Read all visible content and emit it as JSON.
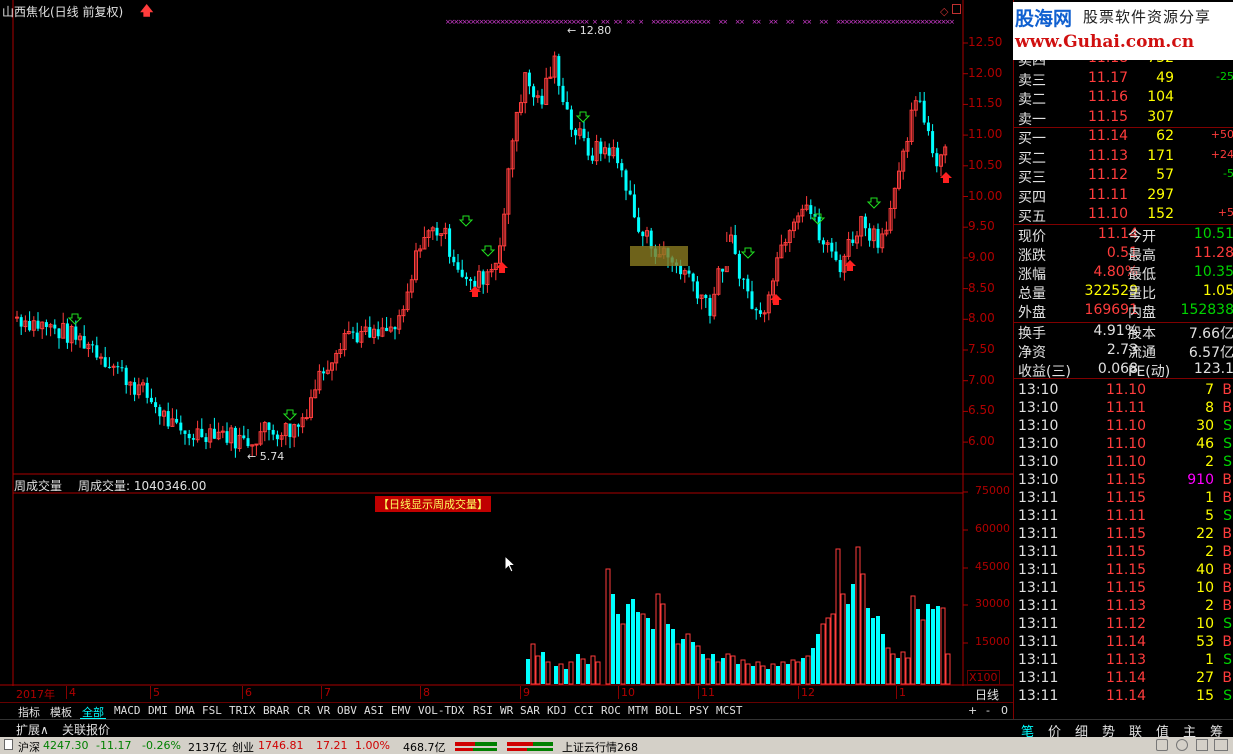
{
  "header": {
    "stock_title": "山西焦化(日线 前复权)",
    "high_mark": "12.80",
    "low_mark": "5.74"
  },
  "price_axis": [
    "12.50",
    "12.00",
    "11.50",
    "11.00",
    "10.50",
    "10.00",
    "9.50",
    "9.00",
    "8.50",
    "8.00",
    "7.50",
    "7.00",
    "6.50",
    "6.00"
  ],
  "volume_panel": {
    "label1": "周成交量",
    "label2": "周成交量: 1040346.00",
    "notice": "【日线显示周成交量】",
    "axis": [
      "75000",
      "60000",
      "45000",
      "30000",
      "15000"
    ],
    "unit": "X100"
  },
  "months": {
    "year": "2017年",
    "labels": [
      "4",
      "5",
      "6",
      "7",
      "8",
      "9",
      "10",
      "11",
      "12",
      "1"
    ],
    "period": "日线"
  },
  "indicator_tabs": [
    "指标",
    "模板",
    "全部",
    "MACD",
    "DMI",
    "DMA",
    "FSL",
    "TRIX",
    "BRAR",
    "CR",
    "VR",
    "OBV",
    "ASI",
    "EMV",
    "VOL-TDX",
    "RSI",
    "WR",
    "SAR",
    "KDJ",
    "CCI",
    "ROC",
    "MTM",
    "BOLL",
    "PSY",
    "MCST"
  ],
  "zoom_controls": [
    "+",
    "-",
    "0"
  ],
  "expand_bar": {
    "expand": "扩展∧",
    "related": "关联报价"
  },
  "watermark": {
    "brand": "股海网",
    "slogan": "股票软件资源分享",
    "url": "www.Guhai.com.cn"
  },
  "order_book": [
    {
      "label": "卖四",
      "price": "11.18",
      "vol": "732",
      "chg": ""
    },
    {
      "label": "卖三",
      "price": "11.17",
      "vol": "49",
      "chg": "-25"
    },
    {
      "label": "卖二",
      "price": "11.16",
      "vol": "104",
      "chg": ""
    },
    {
      "label": "卖一",
      "price": "11.15",
      "vol": "307",
      "chg": ""
    },
    {
      "label": "买一",
      "price": "11.14",
      "vol": "62",
      "chg": "+50"
    },
    {
      "label": "买二",
      "price": "11.13",
      "vol": "171",
      "chg": "+24"
    },
    {
      "label": "买三",
      "price": "11.12",
      "vol": "57",
      "chg": "-5"
    },
    {
      "label": "买四",
      "price": "11.11",
      "vol": "297",
      "chg": ""
    },
    {
      "label": "买五",
      "price": "11.10",
      "vol": "152",
      "chg": "+5"
    }
  ],
  "stats": [
    {
      "l1": "现价",
      "v1": "11.14",
      "l2": "今开",
      "v2": "10.51"
    },
    {
      "l1": "涨跌",
      "v1": "0.51",
      "l2": "最高",
      "v2": "11.28"
    },
    {
      "l1": "涨幅",
      "v1": "4.80%",
      "l2": "最低",
      "v2": "10.35"
    },
    {
      "l1": "总量",
      "v1": "322529",
      "l2": "量比",
      "v2": "1.05"
    },
    {
      "l1": "外盘",
      "v1": "169691",
      "l2": "内盘",
      "v2": "152838"
    }
  ],
  "stats2": [
    {
      "l1": "换手",
      "v1": "4.91%",
      "l2": "股本",
      "v2": "7.66亿"
    },
    {
      "l1": "净资",
      "v1": "2.73",
      "l2": "流通",
      "v2": "6.57亿"
    },
    {
      "l1": "收益(三)",
      "v1": "0.068",
      "l2": "PE(动)",
      "v2": "123.1"
    }
  ],
  "ticks": [
    {
      "t": "13:10",
      "p": "11.10",
      "v": "7",
      "s": "B"
    },
    {
      "t": "13:10",
      "p": "11.11",
      "v": "8",
      "s": "B"
    },
    {
      "t": "13:10",
      "p": "11.10",
      "v": "30",
      "s": "S"
    },
    {
      "t": "13:10",
      "p": "11.10",
      "v": "46",
      "s": "S"
    },
    {
      "t": "13:10",
      "p": "11.10",
      "v": "2",
      "s": "S"
    },
    {
      "t": "13:10",
      "p": "11.15",
      "v": "910",
      "s": "B"
    },
    {
      "t": "13:11",
      "p": "11.15",
      "v": "1",
      "s": "B"
    },
    {
      "t": "13:11",
      "p": "11.11",
      "v": "5",
      "s": "S"
    },
    {
      "t": "13:11",
      "p": "11.15",
      "v": "22",
      "s": "B"
    },
    {
      "t": "13:11",
      "p": "11.15",
      "v": "2",
      "s": "B"
    },
    {
      "t": "13:11",
      "p": "11.15",
      "v": "40",
      "s": "B"
    },
    {
      "t": "13:11",
      "p": "11.15",
      "v": "10",
      "s": "B"
    },
    {
      "t": "13:11",
      "p": "11.13",
      "v": "2",
      "s": "B"
    },
    {
      "t": "13:11",
      "p": "11.12",
      "v": "10",
      "s": "S"
    },
    {
      "t": "13:11",
      "p": "11.14",
      "v": "53",
      "s": "B"
    },
    {
      "t": "13:11",
      "p": "11.13",
      "v": "1",
      "s": "S"
    },
    {
      "t": "13:11",
      "p": "11.14",
      "v": "27",
      "s": "B"
    },
    {
      "t": "13:11",
      "p": "11.14",
      "v": "15",
      "s": "S"
    }
  ],
  "right_tabs": [
    "笔",
    "价",
    "细",
    "势",
    "联",
    "值",
    "主",
    "筹"
  ],
  "status_bar": {
    "idx1_name": "沪深",
    "idx1_val": "4247.30",
    "idx1_chg": "-11.17",
    "idx1_pct": "-0.26%",
    "idx1_amt": "2137亿",
    "idx2_name": "创业",
    "idx2_val": "1746.81",
    "idx2_chg": "17.21",
    "idx2_pct": "1.00%",
    "idx2_amt": "468.7亿",
    "cloud": "上证云行情",
    "cloud_num": "268"
  },
  "colors": {
    "up": "#ff3c3c",
    "down": "#00ffff",
    "frame": "#aa0000",
    "axis_text": "#b00000"
  }
}
